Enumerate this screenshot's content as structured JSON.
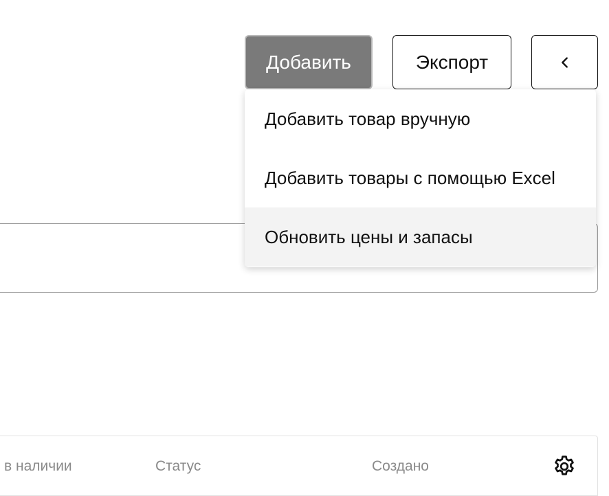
{
  "toolbar": {
    "add_label": "Добавить",
    "export_label": "Экспорт"
  },
  "add_menu": {
    "items": [
      {
        "label": "Добавить товар вручную"
      },
      {
        "label": "Добавить товары с помощью Excel"
      },
      {
        "label": "Обновить цены и запасы"
      }
    ]
  },
  "table": {
    "columns": [
      {
        "label": "в наличии"
      },
      {
        "label": "Статус"
      },
      {
        "label": "Создано"
      }
    ]
  },
  "icons": {
    "back": "chevron-left-icon",
    "settings": "gear-icon"
  },
  "colors": {
    "add_button_bg": "#7a7a7a",
    "menu_hover_bg": "#f3f3f3",
    "header_text": "#8a8a8a"
  }
}
